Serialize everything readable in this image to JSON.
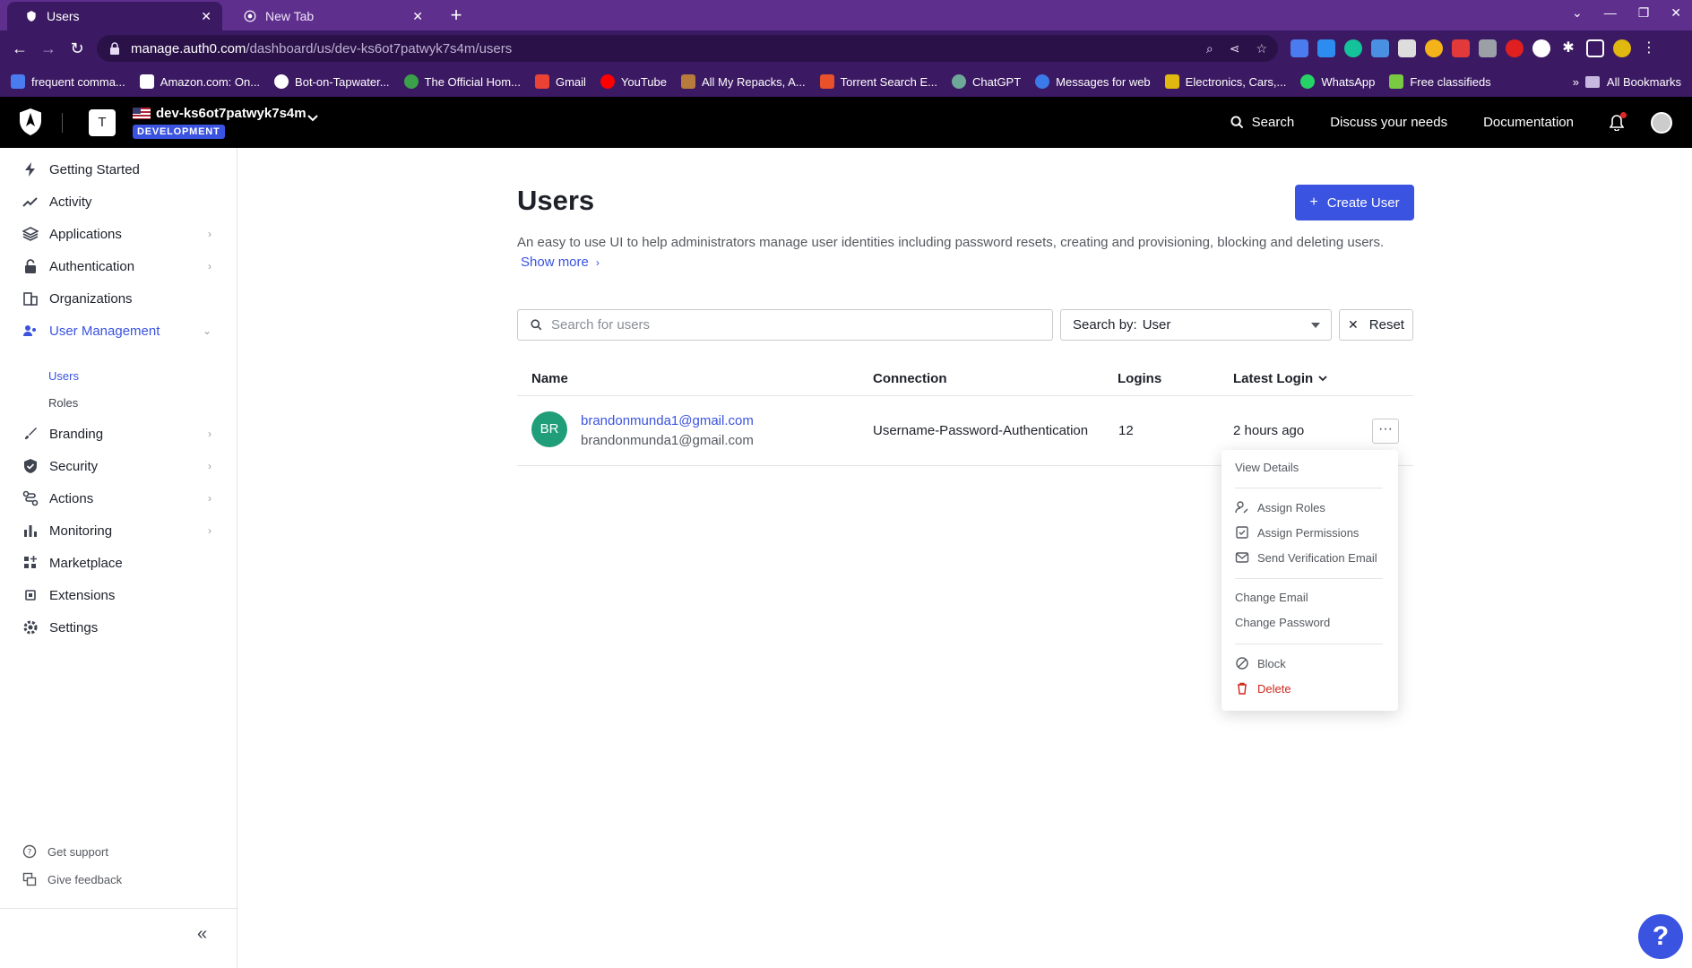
{
  "browser": {
    "tabs": [
      {
        "title": "Users",
        "active": true
      },
      {
        "title": "New Tab",
        "active": false
      }
    ],
    "url_domain": "manage.auth0.com",
    "url_path": "/dashboard/us/dev-ks6ot7patwyk7s4m/users",
    "bookmarks": [
      {
        "label": "frequent comma...",
        "color": "#4a7cf0"
      },
      {
        "label": "Amazon.com: On...",
        "color": "#ffffff"
      },
      {
        "label": "Bot-on-Tapwater...",
        "color": "#ffffff"
      },
      {
        "label": "The Official Hom...",
        "color": "#3aa14a"
      },
      {
        "label": "Gmail",
        "color": "#ea4335"
      },
      {
        "label": "YouTube",
        "color": "#ff0000"
      },
      {
        "label": "All My Repacks, A...",
        "color": "#b77b3c"
      },
      {
        "label": "Torrent Search E...",
        "color": "#e8512a"
      },
      {
        "label": "ChatGPT",
        "color": "#6ea898"
      },
      {
        "label": "Messages for web",
        "color": "#3b7be9"
      },
      {
        "label": "Electronics, Cars,...",
        "color": "#e0b80f"
      },
      {
        "label": "WhatsApp",
        "color": "#25d366"
      },
      {
        "label": "Free classifieds",
        "color": "#7ac943"
      }
    ],
    "all_bookmarks": "All Bookmarks",
    "more_bookmarks": "»"
  },
  "header": {
    "tenant_initial": "T",
    "tenant_name": "dev-ks6ot7patwyk7s4m",
    "env_badge": "DEVELOPMENT",
    "search": "Search",
    "discuss": "Discuss your needs",
    "docs": "Documentation"
  },
  "sidebar": {
    "items": [
      {
        "label": "Getting Started",
        "icon": "bolt-icon"
      },
      {
        "label": "Activity",
        "icon": "activity-icon"
      },
      {
        "label": "Applications",
        "icon": "layers-icon"
      },
      {
        "label": "Authentication",
        "icon": "lock-icon"
      },
      {
        "label": "Organizations",
        "icon": "building-icon"
      },
      {
        "label": "User Management",
        "icon": "users-icon"
      },
      {
        "label": "Branding",
        "icon": "brush-icon"
      },
      {
        "label": "Security",
        "icon": "shield-icon"
      },
      {
        "label": "Actions",
        "icon": "actions-icon"
      },
      {
        "label": "Monitoring",
        "icon": "chart-icon"
      },
      {
        "label": "Marketplace",
        "icon": "grid-plus-icon"
      },
      {
        "label": "Extensions",
        "icon": "chip-icon"
      },
      {
        "label": "Settings",
        "icon": "gear-icon"
      }
    ],
    "sub_items": [
      {
        "label": "Users"
      },
      {
        "label": "Roles"
      }
    ],
    "footer": [
      {
        "label": "Get support",
        "icon": "help-circle-icon"
      },
      {
        "label": "Give feedback",
        "icon": "feedback-icon"
      }
    ],
    "collapse": "«"
  },
  "main": {
    "title": "Users",
    "create_button": "Create User",
    "description": "An easy to use UI to help administrators manage user identities including password resets, creating and provisioning, blocking and deleting users.",
    "show_more": "Show more",
    "search_placeholder": "Search for users",
    "search_by_label": "Search by:",
    "search_by_value": "User",
    "reset": "Reset",
    "columns": [
      "Name",
      "Connection",
      "Logins",
      "Latest Login"
    ],
    "rows": [
      {
        "initials": "BR",
        "email": "brandonmunda1@gmail.com",
        "sub": "brandonmunda1@gmail.com",
        "connection": "Username-Password-Authentication",
        "logins": "12",
        "latest_login": "2 hours ago"
      }
    ],
    "more_button": "···"
  },
  "dropdown": {
    "view_details": "View Details",
    "assign_roles": "Assign Roles",
    "assign_permissions": "Assign Permissions",
    "send_verification": "Send Verification Email",
    "change_email": "Change Email",
    "change_password": "Change Password",
    "block": "Block",
    "delete": "Delete"
  },
  "help": "?",
  "colors": {
    "accent": "#3a53e0",
    "danger": "#d0271d",
    "avatar": "#1f9e79",
    "browser": "#3c1a63"
  }
}
